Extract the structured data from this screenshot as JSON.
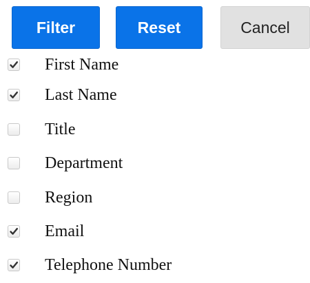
{
  "toolbar": {
    "filter_label": "Filter",
    "reset_label": "Reset",
    "cancel_label": "Cancel"
  },
  "colors": {
    "primary_button": "#0a73e8",
    "secondary_button": "#e1e1e1",
    "checkbox_border": "#c8c8c8"
  },
  "options": [
    {
      "label": "First Name",
      "checked": true
    },
    {
      "label": "Last Name",
      "checked": true
    },
    {
      "label": "Title",
      "checked": false
    },
    {
      "label": "Department",
      "checked": false
    },
    {
      "label": "Region",
      "checked": false
    },
    {
      "label": "Email",
      "checked": true
    },
    {
      "label": "Telephone Number",
      "checked": true
    }
  ]
}
